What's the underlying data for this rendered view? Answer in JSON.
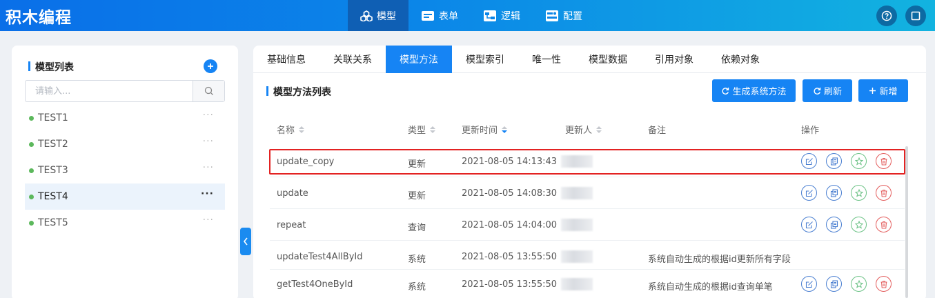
{
  "app": {
    "title": "积木编程"
  },
  "nav": [
    {
      "label": "模型",
      "icon": "cubes-icon",
      "active": true
    },
    {
      "label": "表单",
      "icon": "form-icon",
      "active": false
    },
    {
      "label": "逻辑",
      "icon": "logic-icon",
      "active": false
    },
    {
      "label": "配置",
      "icon": "config-icon",
      "active": false
    }
  ],
  "sidebar": {
    "title": "模型列表",
    "search_placeholder": "请输入...",
    "items": [
      {
        "label": "TEST1",
        "active": false
      },
      {
        "label": "TEST2",
        "active": false
      },
      {
        "label": "TEST3",
        "active": false
      },
      {
        "label": "TEST4",
        "active": true
      },
      {
        "label": "TEST5",
        "active": false
      }
    ]
  },
  "tabs": [
    {
      "label": "基础信息",
      "active": false
    },
    {
      "label": "关联关系",
      "active": false
    },
    {
      "label": "模型方法",
      "active": true
    },
    {
      "label": "模型索引",
      "active": false
    },
    {
      "label": "唯一性",
      "active": false
    },
    {
      "label": "模型数据",
      "active": false
    },
    {
      "label": "引用对象",
      "active": false
    },
    {
      "label": "依赖对象",
      "active": false
    }
  ],
  "section": {
    "title": "模型方法列表",
    "buttons": {
      "generate": "生成系统方法",
      "refresh": "刷新",
      "add": "新增"
    }
  },
  "table": {
    "columns": [
      "名称",
      "类型",
      "更新时间",
      "更新人",
      "备注",
      "操作"
    ],
    "rows": [
      {
        "name": "update_copy",
        "type": "更新",
        "time": "2021-08-05 14:13:43",
        "note": "",
        "actions": true
      },
      {
        "name": "update",
        "type": "更新",
        "time": "2021-08-05 14:08:30",
        "note": "",
        "actions": true
      },
      {
        "name": "repeat",
        "type": "查询",
        "time": "2021-08-05 14:04:00",
        "note": "",
        "actions": true
      },
      {
        "name": "updateTest4AllById",
        "type": "系统",
        "time": "2021-08-05 13:55:50",
        "note": "系统自动生成的根据id更新所有字段",
        "actions": false
      },
      {
        "name": "getTest4OneById",
        "type": "系统",
        "time": "2021-08-05 13:55:50",
        "note": "系统自动生成的根据id查询单笔",
        "actions": true
      }
    ]
  },
  "colors": {
    "primary": "#1684f4",
    "highlight": "#e32222",
    "status_dot": "#5cb85c"
  }
}
